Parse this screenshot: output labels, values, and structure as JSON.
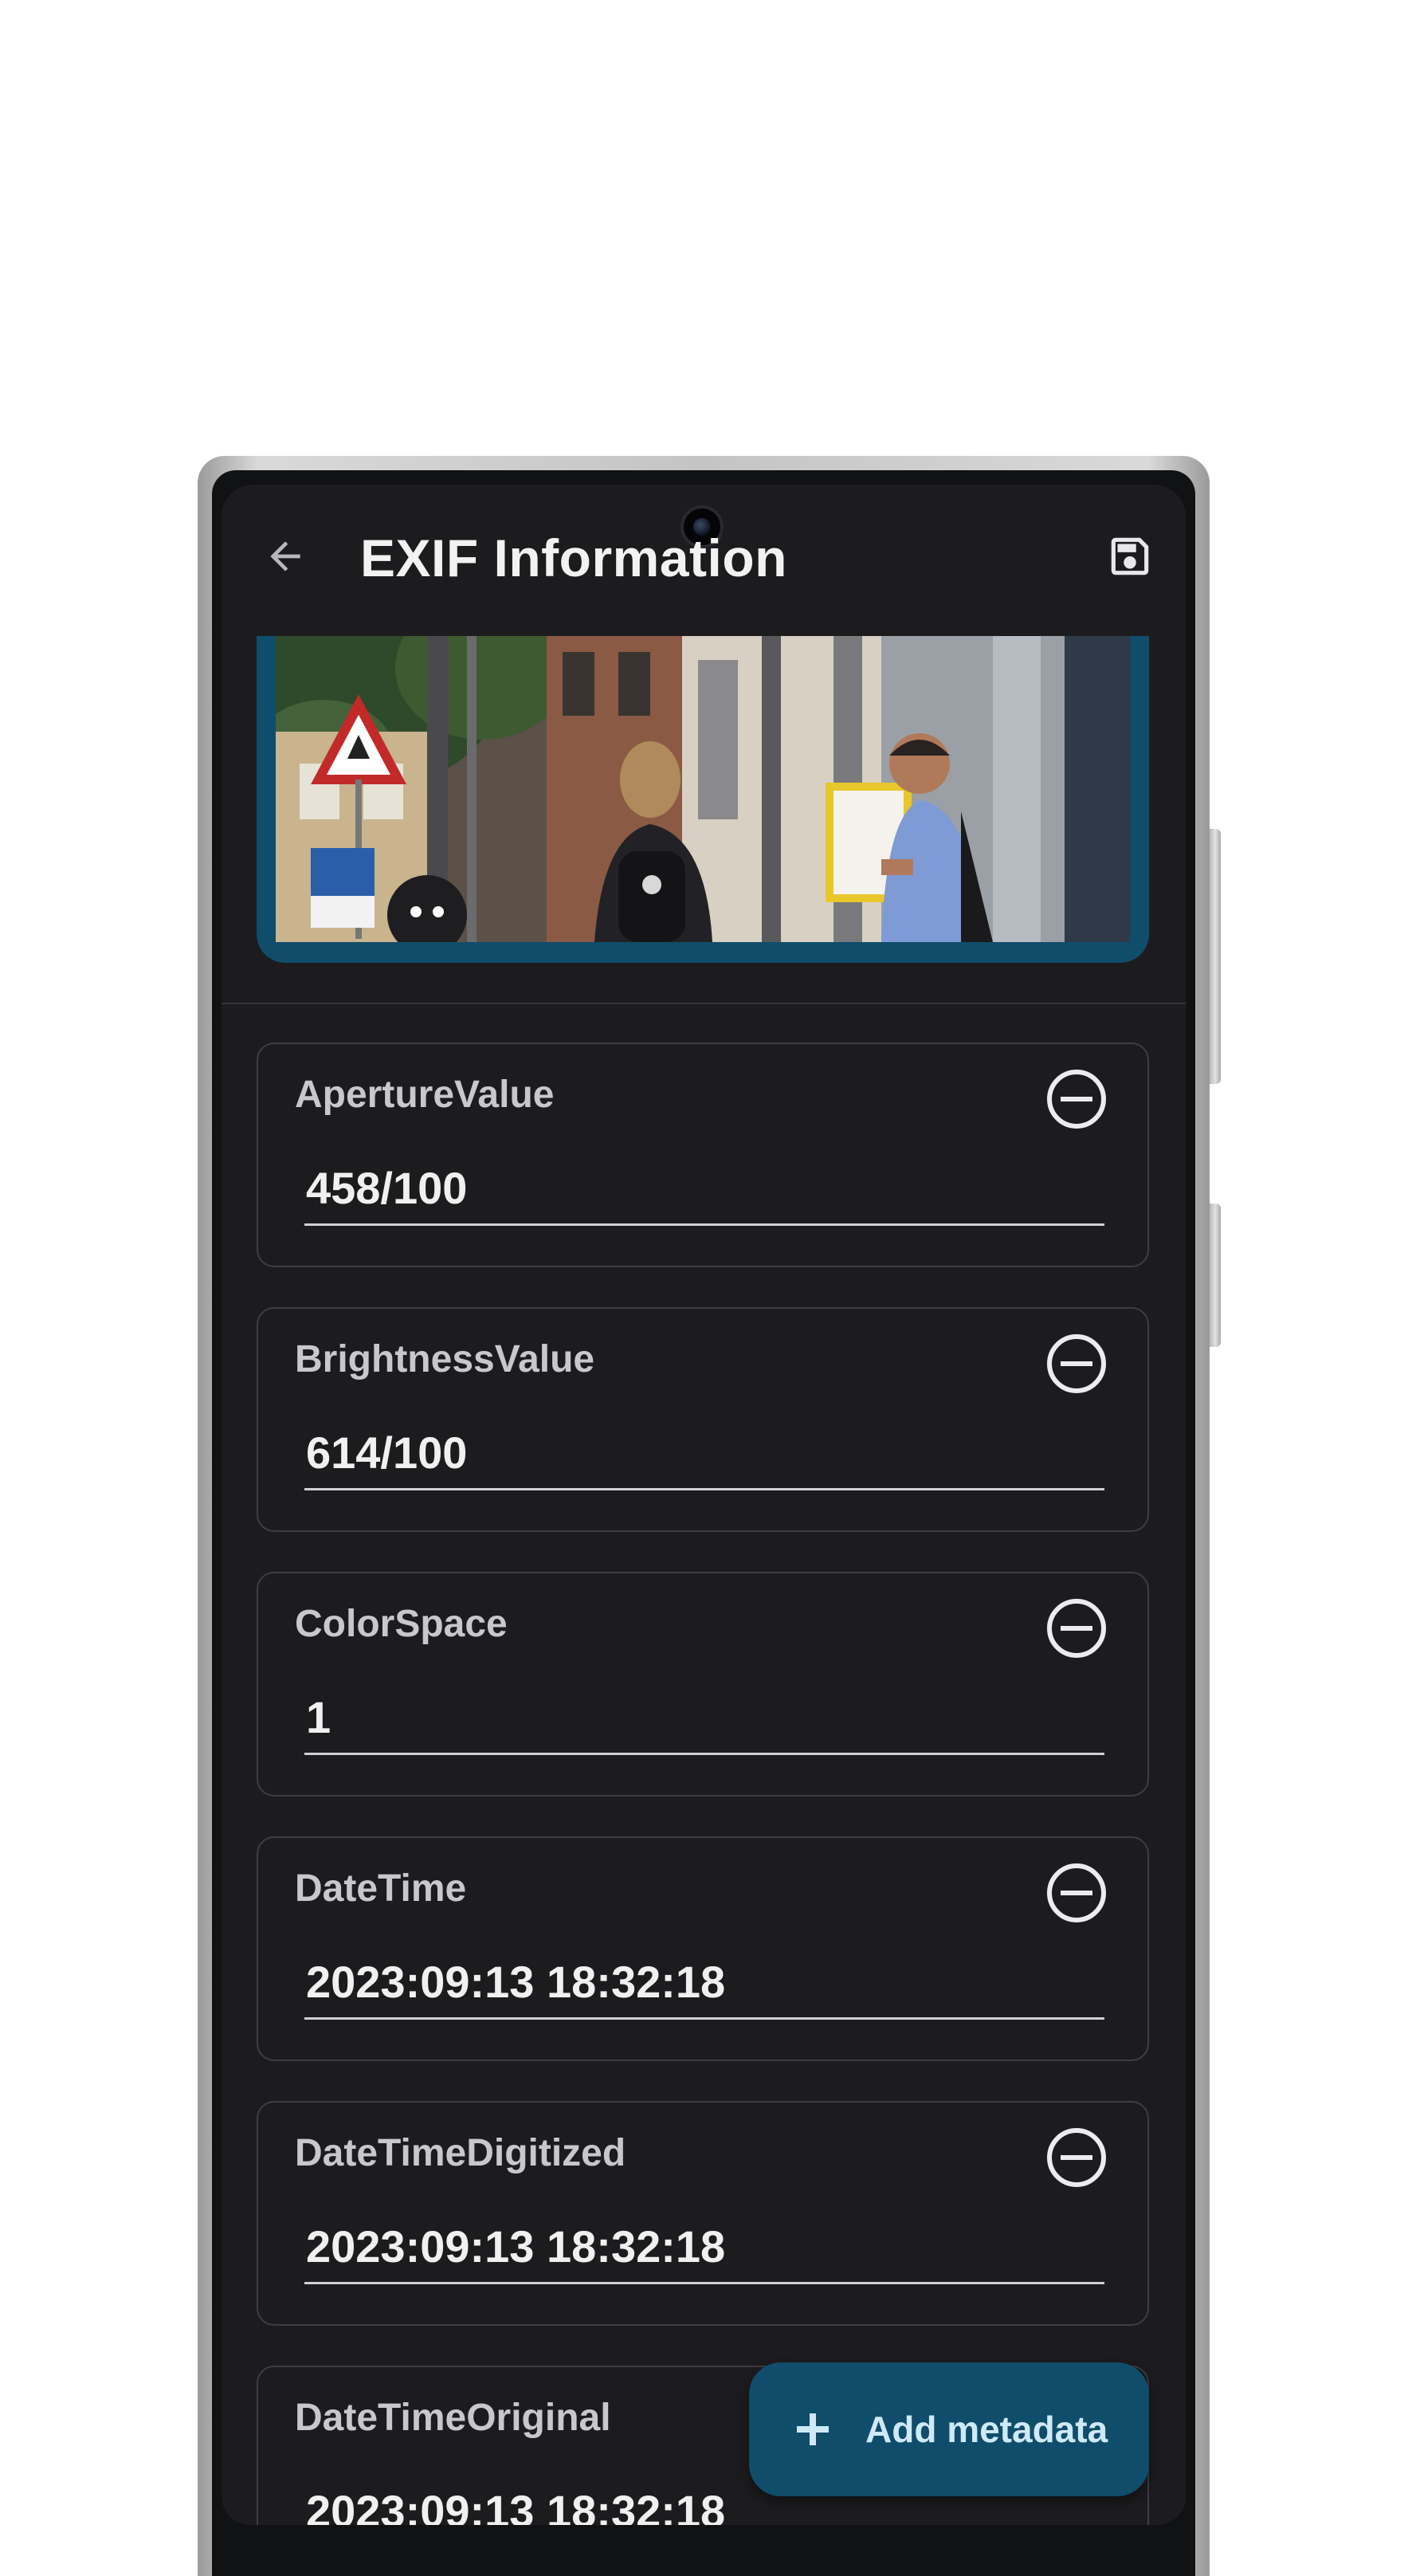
{
  "app_bar": {
    "title": "EXIF Information",
    "back_icon": "arrow-left-icon",
    "save_icon": "save-floppy-icon"
  },
  "preview": {
    "description_icon": "photo-preview"
  },
  "metadata": [
    {
      "key": "ApertureValue",
      "value": "458/100"
    },
    {
      "key": "BrightnessValue",
      "value": "614/100"
    },
    {
      "key": "ColorSpace",
      "value": "1"
    },
    {
      "key": "DateTime",
      "value": "2023:09:13 18:32:18"
    },
    {
      "key": "DateTimeDigitized",
      "value": "2023:09:13 18:32:18"
    },
    {
      "key": "DateTimeOriginal",
      "value": "2023:09:13 18:32:18"
    }
  ],
  "fab": {
    "label": "Add metadata",
    "icon": "plus-icon"
  },
  "colors": {
    "background": "#1c1c1e",
    "accent": "#0f4d6b",
    "text": "#f0f0f0"
  }
}
